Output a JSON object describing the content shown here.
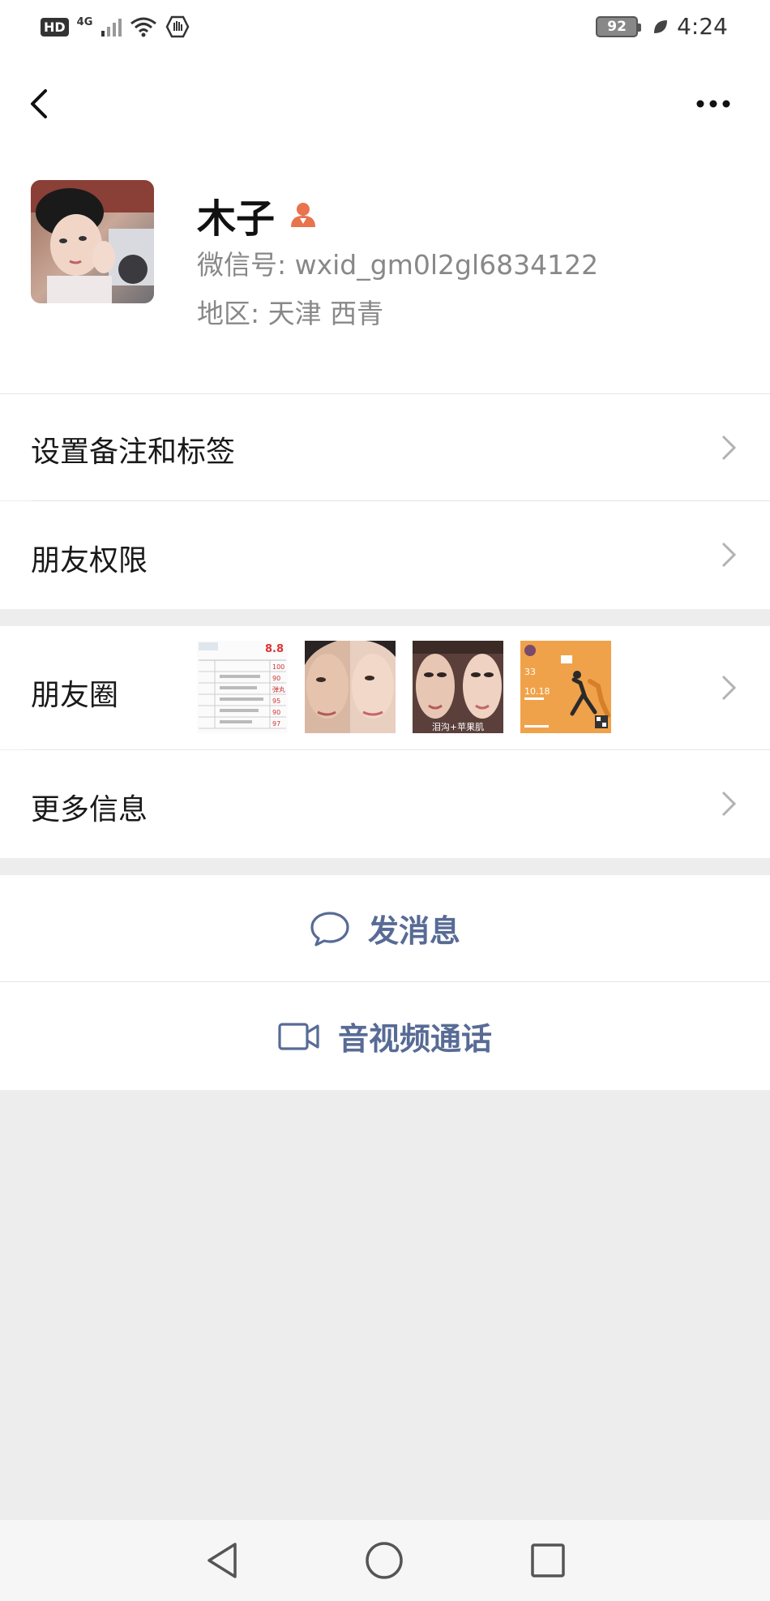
{
  "status_bar": {
    "hd": "HD",
    "network": "4G",
    "battery": "92",
    "time": "4:24"
  },
  "profile": {
    "name": "木子",
    "wechat_id": "微信号: wxid_gm0l2gl6834122",
    "region": "地区: 天津  西青"
  },
  "menu": {
    "set_remark": "设置备注和标签",
    "friend_permissions": "朋友权限",
    "moments": "朋友圈",
    "more_info": "更多信息"
  },
  "actions": {
    "send_message": "发消息",
    "video_call": "音视频通话"
  },
  "moments_thumb_text": {
    "score": "8.8",
    "rows": [
      "100",
      "90",
      "弹丸",
      "95",
      "90",
      "97"
    ],
    "caption_2": "泪沟+苹果肌",
    "run_stat_1": "33",
    "run_stat_2": "10.18"
  },
  "colors": {
    "link": "#576b95",
    "avatar_badge": "#e8734d",
    "page_bg": "#ededed"
  },
  "icons": {
    "back": "chevron-left-icon",
    "more": "ellipsis-icon",
    "gender": "female-contact-icon",
    "message": "chat-bubble-icon",
    "video": "video-camera-icon"
  }
}
